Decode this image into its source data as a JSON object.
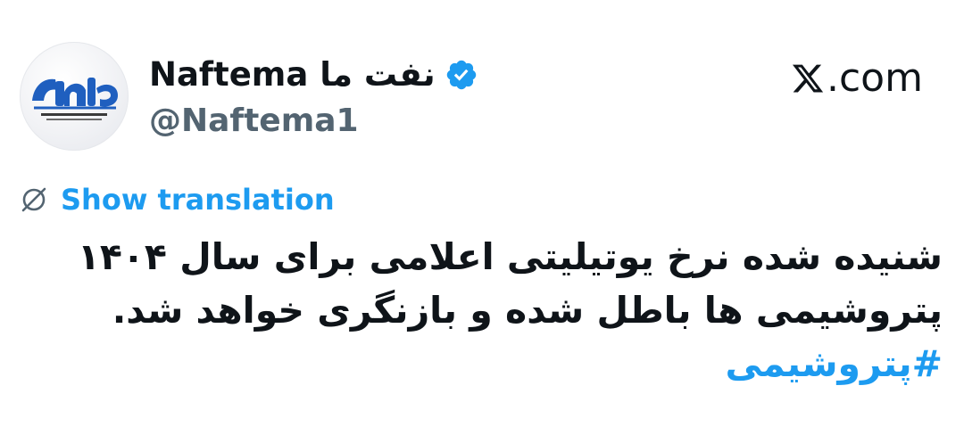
{
  "author": {
    "display_name": "Naftema نفت ما",
    "handle": "@Naftema1",
    "avatar_icon": "naftema-logo-icon",
    "verified_icon": "verified-badge-icon",
    "verified_color": "#1d9bf0"
  },
  "brand": {
    "icon": "x-logo-icon",
    "label": ".com"
  },
  "translation": {
    "icon": "globe-strike-icon",
    "label": "Show translation",
    "color": "#1d9bf0"
  },
  "tweet": {
    "lines": [
      "شنیده شده نرخ یوتیلیتی اعلامی برای سال ۱۴۰۴",
      "پتروشیمی ها باطل شده و بازنگری خواهد شد."
    ],
    "hashtag": "#پتروشیمی",
    "text_color": "#0f1419",
    "hashtag_color": "#1d9bf0"
  }
}
